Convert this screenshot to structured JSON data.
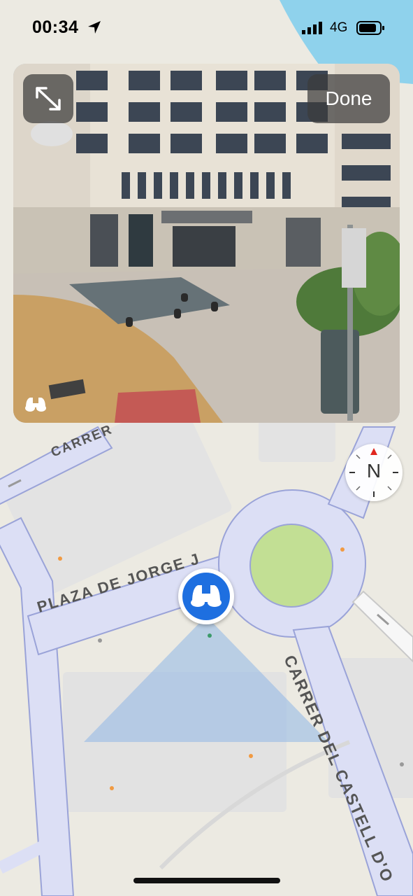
{
  "status_bar": {
    "time": "00:34",
    "network": "4G"
  },
  "look_around": {
    "done_label": "Done",
    "expand_icon": "expand-arrows-icon",
    "mode_icon": "binoculars-icon"
  },
  "compass": {
    "label": "N"
  },
  "map": {
    "street_labels": {
      "plaza": "PLAZA DE JORGE J",
      "castell": "CARRER DEL CASTELL D'O",
      "carrer": "CARRER"
    },
    "colors": {
      "land": "#eceae2",
      "road": "#dcdff5",
      "road_edge": "#9aa3d8",
      "park": "#c2df94",
      "water": "#8fd2ec",
      "marker": "#1e6fe0"
    }
  }
}
